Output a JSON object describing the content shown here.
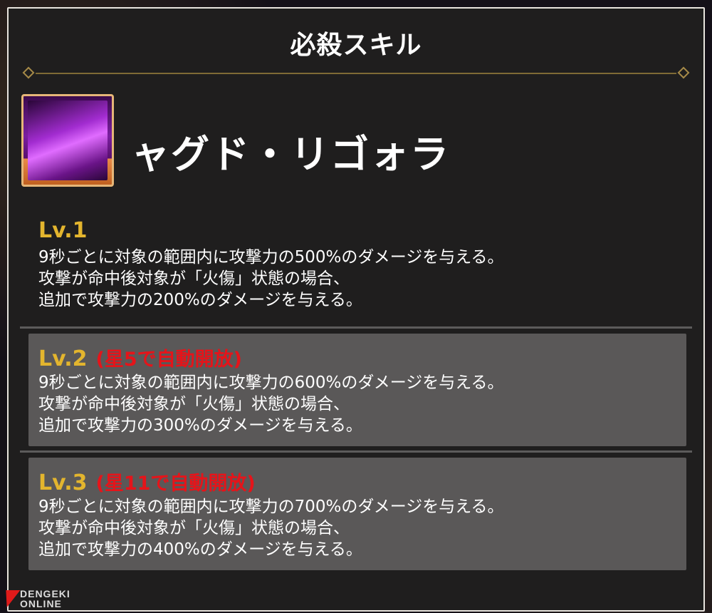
{
  "panel": {
    "title": "必殺スキル"
  },
  "skill": {
    "icon": "purple-flame-skill-icon",
    "name": "ャグド・リゴォラ"
  },
  "levels": [
    {
      "label": "Lv.1",
      "unlock": "",
      "lines": [
        "9秒ごとに対象の範囲内に攻撃力の500%のダメージを与える。",
        "攻撃が命中後対象が「火傷」状態の場合、",
        "追加で攻撃力の200%のダメージを与える。"
      ]
    },
    {
      "label": "Lv.2",
      "unlock": "(星5で自動開放)",
      "lines": [
        "9秒ごとに対象の範囲内に攻撃力の600%のダメージを与える。",
        "攻撃が命中後対象が「火傷」状態の場合、",
        "追加で攻撃力の300%のダメージを与える。"
      ]
    },
    {
      "label": "Lv.3",
      "unlock": "(星11で自動開放)",
      "lines": [
        "9秒ごとに対象の範囲内に攻撃力の700%のダメージを与える。",
        "攻撃が命中後対象が「火傷」状態の場合、",
        "追加で攻撃力の400%のダメージを与える。"
      ]
    }
  ],
  "watermark": {
    "line1": "DENGEKI",
    "line2": "ONLINE"
  },
  "colors": {
    "level_label": "#e3b52e",
    "unlock_text": "#e5141a",
    "panel_bg": "#1f1e1e",
    "level_box_bg": "#5a5858"
  }
}
